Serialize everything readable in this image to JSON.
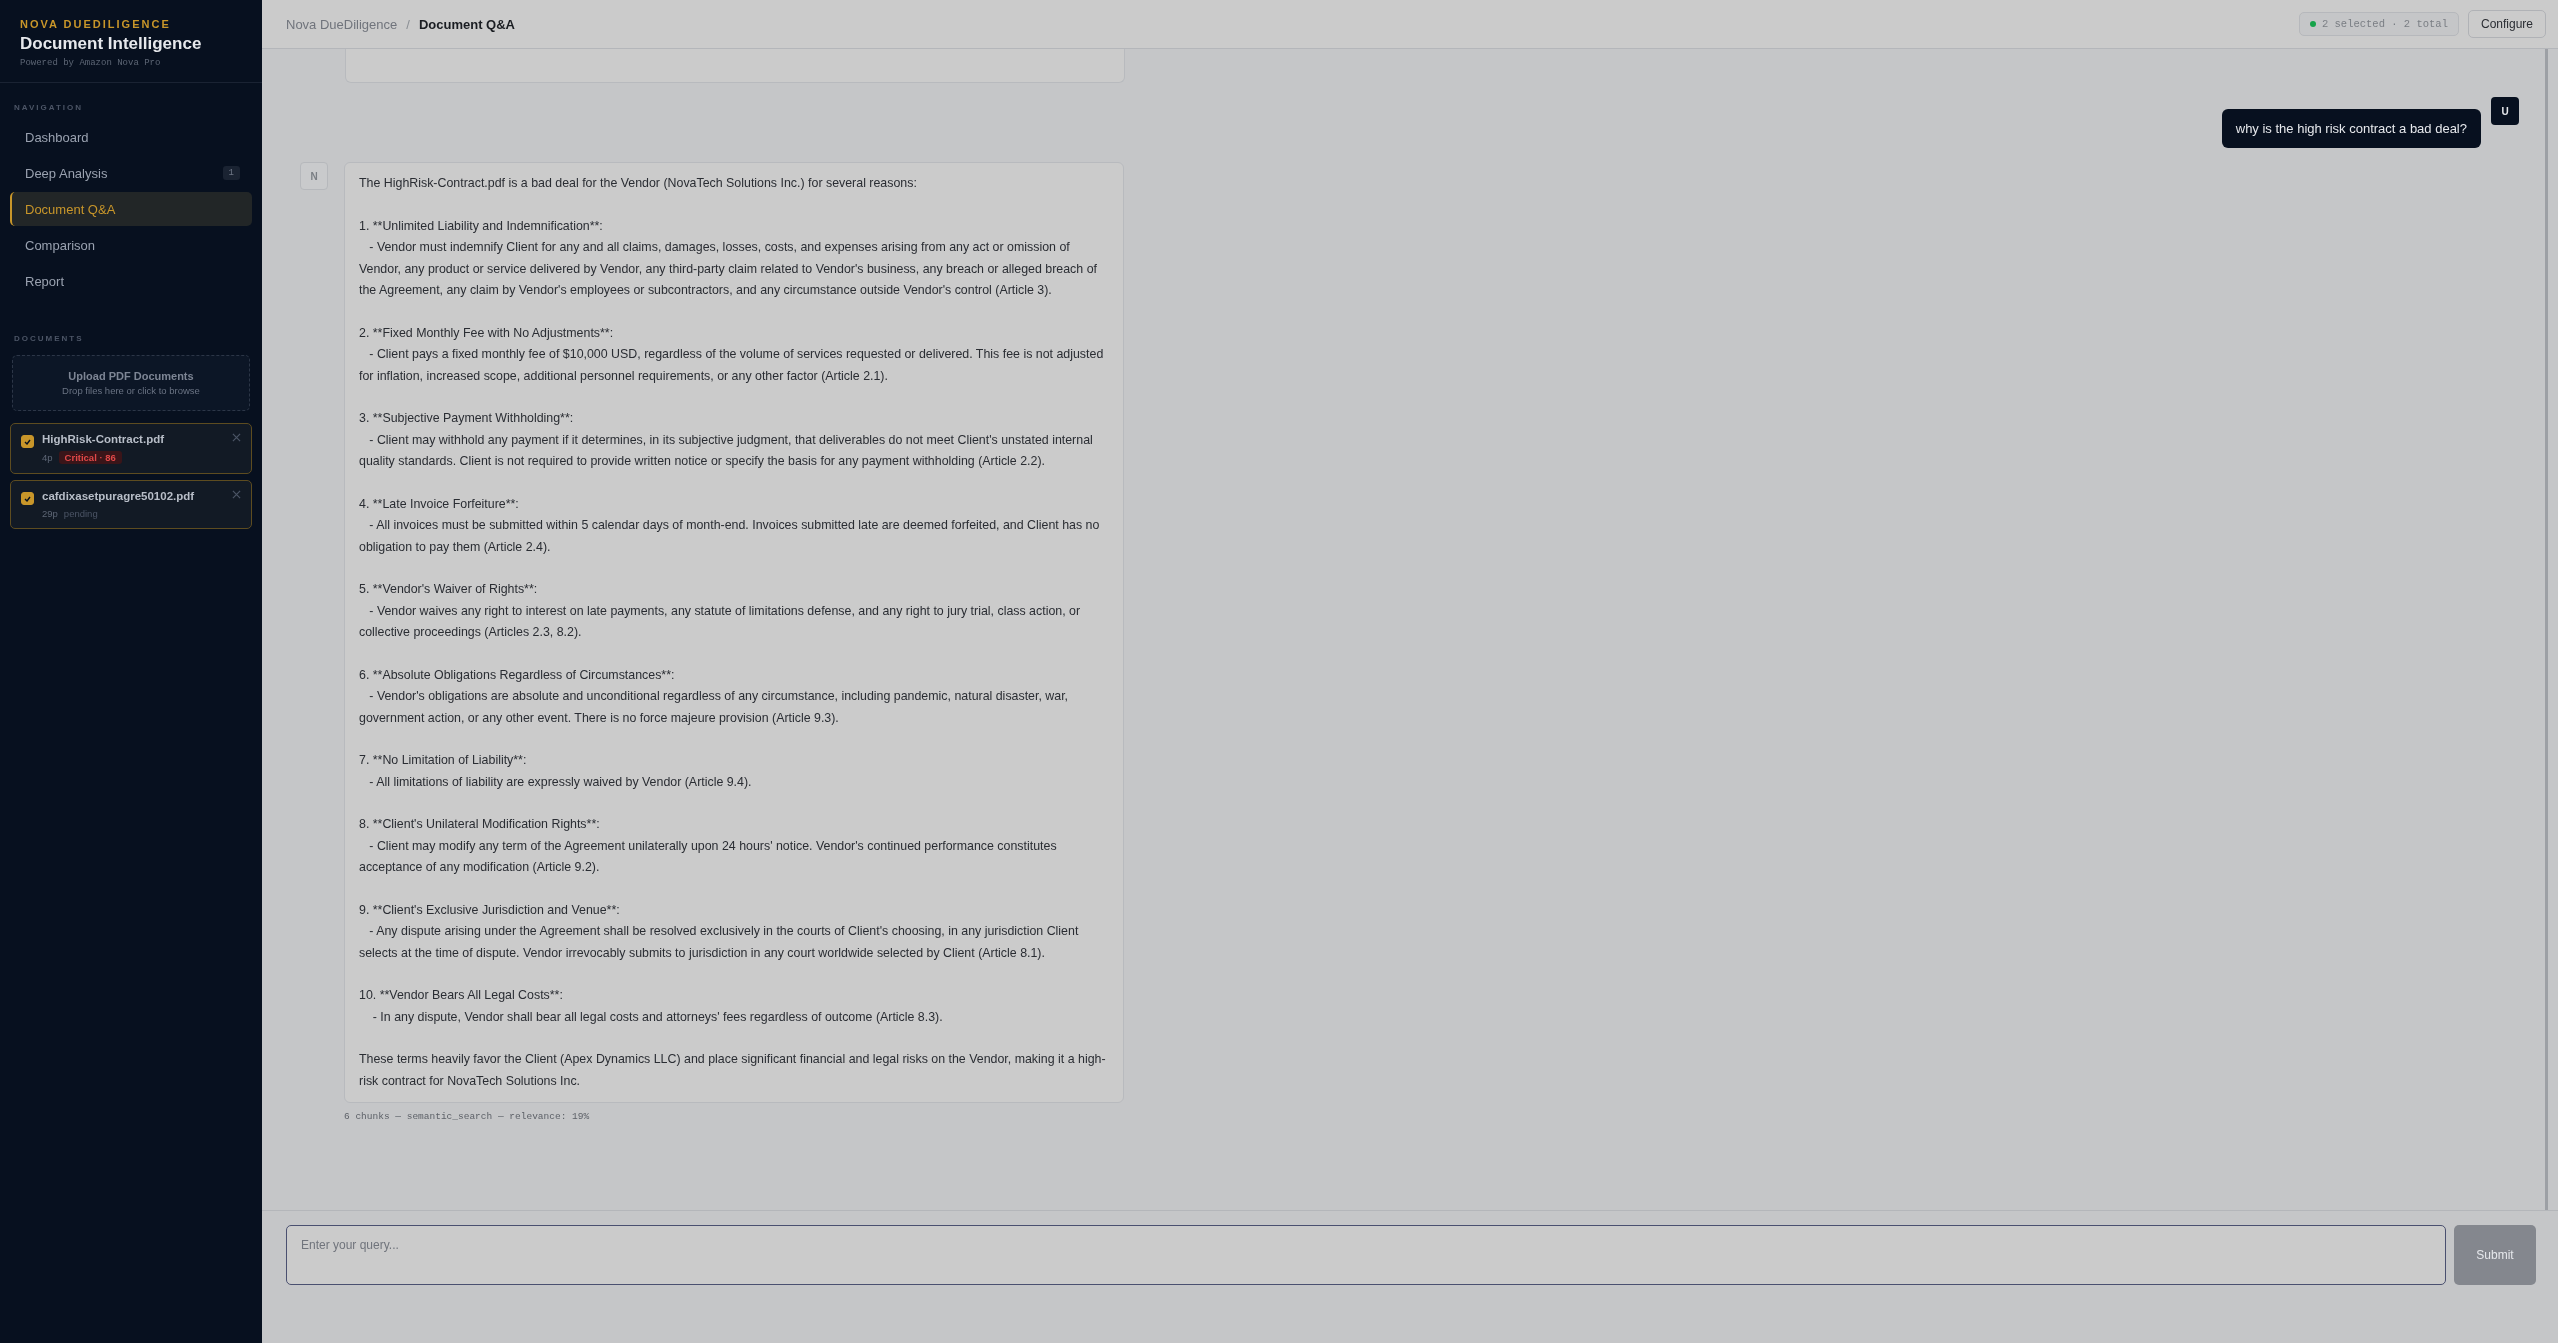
{
  "sidebar": {
    "brand": "NOVA DUEDILIGENCE",
    "title": "Document Intelligence",
    "subtitle": "Powered by Amazon Nova Pro",
    "nav_heading": "NAVIGATION",
    "nav_items": [
      {
        "label": "Dashboard",
        "selected": false
      },
      {
        "label": "Deep Analysis",
        "selected": false,
        "badge": "1"
      },
      {
        "label": "Document Q&A",
        "selected": true
      },
      {
        "label": "Comparison",
        "selected": false
      },
      {
        "label": "Report",
        "selected": false
      }
    ],
    "documents_heading": "DOCUMENTS",
    "upload": {
      "title": "Upload PDF Documents",
      "hint": "Drop files here or click to browse"
    },
    "documents": [
      {
        "name": "HighRisk-Contract.pdf",
        "checked": true,
        "pages": "4p",
        "status": "Critical · 86",
        "kind": "risk"
      },
      {
        "name": "cafdixasetpuragre50102.pdf",
        "checked": true,
        "pages": "29p",
        "status": "pending",
        "kind": "pending"
      }
    ]
  },
  "topbar": {
    "breadcrumb": [
      "Nova DueDiligence",
      "Document Q&A"
    ],
    "separator": "/",
    "selection": "2 selected · 2 total",
    "configure": "Configure"
  },
  "messages": [
    {
      "kind": "partial"
    },
    {
      "kind": "user",
      "avatar": "U",
      "text": "why is the high risk contract a bad deal?"
    },
    {
      "kind": "assistant",
      "avatar": "N",
      "paragraphs": [
        "The HighRisk-Contract.pdf is a bad deal for the Vendor (NovaTech Solutions Inc.) for several reasons:",
        "1. **Unlimited Liability and Indemnification**:\n   - Vendor must indemnify Client for any and all claims, damages, losses, costs, and expenses arising from any act or omission of Vendor, any product or service delivered by Vendor, any third-party claim related to Vendor's business, any breach or alleged breach of the Agreement, any claim by Vendor's employees or subcontractors, and any circumstance outside Vendor's control (Article 3).",
        "2. **Fixed Monthly Fee with No Adjustments**:\n   - Client pays a fixed monthly fee of $10,000 USD, regardless of the volume of services requested or delivered. This fee is not adjusted for inflation, increased scope, additional personnel requirements, or any other factor (Article 2.1).",
        "3. **Subjective Payment Withholding**:\n   - Client may withhold any payment if it determines, in its subjective judgment, that deliverables do not meet Client's unstated internal quality standards. Client is not required to provide written notice or specify the basis for any payment withholding (Article 2.2).",
        "4. **Late Invoice Forfeiture**:\n   - All invoices must be submitted within 5 calendar days of month-end. Invoices submitted late are deemed forfeited, and Client has no obligation to pay them (Article 2.4).",
        "5. **Vendor's Waiver of Rights**:\n   - Vendor waives any right to interest on late payments, any statute of limitations defense, and any right to jury trial, class action, or collective proceedings (Articles 2.3, 8.2).",
        "6. **Absolute Obligations Regardless of Circumstances**:\n   - Vendor's obligations are absolute and unconditional regardless of any circumstance, including pandemic, natural disaster, war, government action, or any other event. There is no force majeure provision (Article 9.3).",
        "7. **No Limitation of Liability**:\n   - All limitations of liability are expressly waived by Vendor (Article 9.4).",
        "8. **Client's Unilateral Modification Rights**:\n   - Client may modify any term of the Agreement unilaterally upon 24 hours' notice. Vendor's continued performance constitutes acceptance of any modification (Article 9.2).",
        "9. **Client's Exclusive Jurisdiction and Venue**:\n   - Any dispute arising under the Agreement shall be resolved exclusively in the courts of Client's choosing, in any jurisdiction Client selects at the time of dispute. Vendor irrevocably submits to jurisdiction in any court worldwide selected by Client (Article 8.1).",
        "10. **Vendor Bears All Legal Costs**:\n    - In any dispute, Vendor shall bear all legal costs and attorneys' fees regardless of outcome (Article 8.3).",
        "These terms heavily favor the Client (Apex Dynamics LLC) and place significant financial and legal risks on the Vendor, making it a high-risk contract for NovaTech Solutions Inc."
      ],
      "meta": "6 chunks — semantic_search — relevance: 19%"
    }
  ],
  "composer": {
    "placeholder": "Enter your query...",
    "submit": "Submit"
  }
}
